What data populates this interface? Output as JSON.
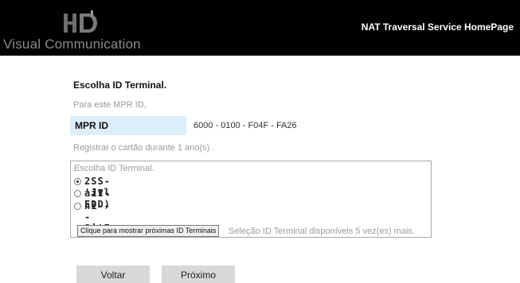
{
  "header": {
    "logo_mark": "HD",
    "logo_subtitle": "Visual Communication",
    "title": "NAT Traversal Service HomePage",
    "background": "#000000"
  },
  "page": {
    "heading": "Escolha ID Terminal.",
    "mpr_note": "Para este MPR ID,",
    "mpr_label": "MPR ID",
    "mpr_value": "6000 - 0100 - F04F - FA26",
    "register_note": "Registrar o cartão durante 1 ano(s) .",
    "choose_legend": "Escolha ID Terminal.",
    "terminals": [
      {
        "value": "2SS-'Jvl",
        "selected": true
      },
      {
        "value": "aiI-EDD)",
        "selected": false
      },
      {
        "value": "ni---Si'I",
        "selected": false
      }
    ],
    "more_button_label": "Clique para mostrar próximas ID Terminais",
    "availability_text": "Seleção ID Terminal disponíveis 5 vez(es) mais.",
    "back_button_label": "Voltar",
    "next_button_label": "Próximo",
    "accent_color": "#ddeefb"
  }
}
